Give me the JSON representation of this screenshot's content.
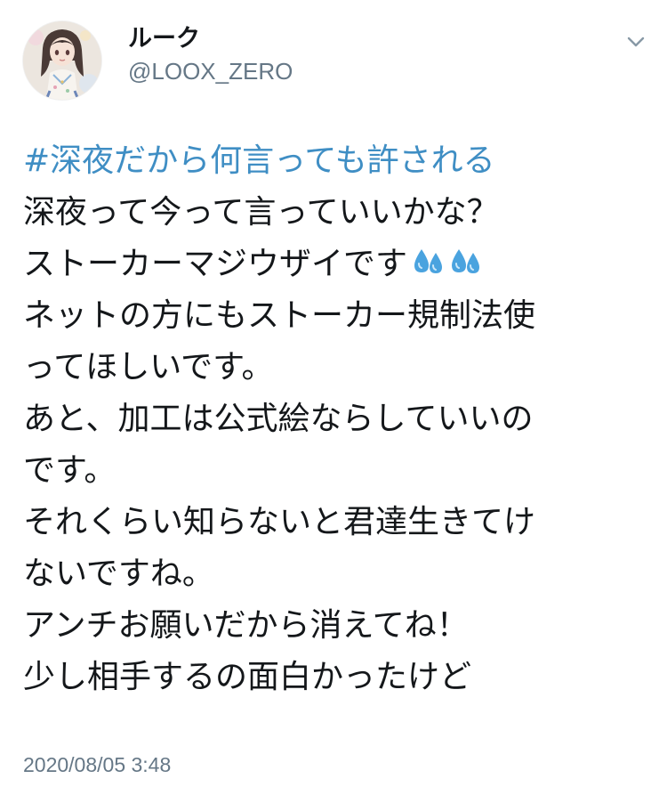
{
  "author": {
    "display_name": "ルーク",
    "handle": "@LOOX_ZERO",
    "avatar_icon": "anime-character-avatar"
  },
  "menu": {
    "icon": "chevron-down-icon"
  },
  "tweet": {
    "hashtag": "#深夜だから何言っても許される",
    "lines": [
      "深夜って今って言っていいかな？",
      "ストーカーマジウザイです",
      "ネットの方にもストーカー規制法使",
      "ってほしいです。",
      "あと、加工は公式絵ならしていいの",
      "です。",
      "それくらい知らないと君達生きてけ",
      "ないですね。",
      "アンチお願いだから消えてね！",
      "少し相手するの面白かったけど"
    ],
    "emoji": [
      "sweat-droplets-icon",
      "sweat-droplets-icon"
    ],
    "timestamp": "2020/08/05 3:48"
  },
  "colors": {
    "hashtag": "#3f8ec4",
    "text": "#14171a",
    "secondary": "#657786"
  }
}
